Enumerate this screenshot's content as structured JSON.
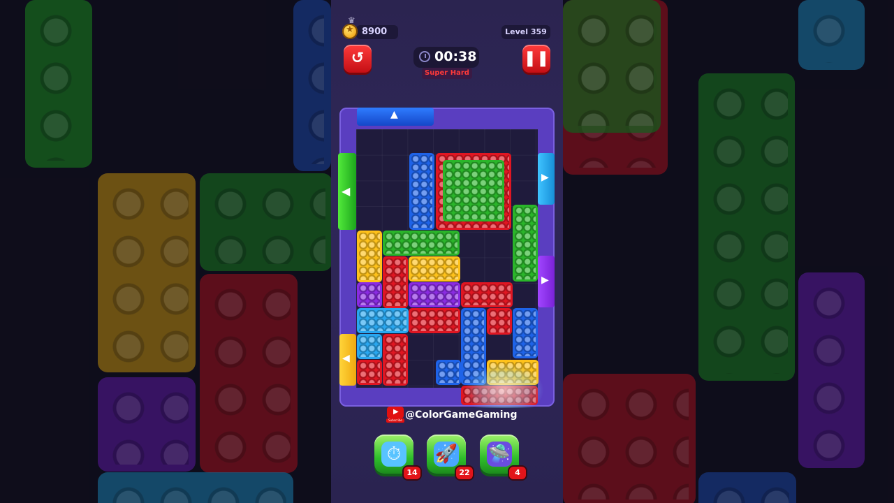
{
  "header": {
    "coins": "8900",
    "level": "Level 359",
    "timer": "00:38",
    "difficulty": "Super Hard"
  },
  "controls": {
    "restart_icon": "restart-icon",
    "pause_icon": "pause-icon"
  },
  "board": {
    "block_colors": {
      "red": "#e01622",
      "green": "#2ab52a",
      "blue": "#1e63e8",
      "yellow": "#ffc21a",
      "purple": "#8a2be2",
      "cyan": "#29a7f0"
    }
  },
  "watermark": {
    "handle": "@ColorGameGaming",
    "subscribe": "Subscribe"
  },
  "boosters": [
    {
      "name": "freeze-clock",
      "icon": "clock-freeze-icon",
      "count": "14"
    },
    {
      "name": "rocket",
      "icon": "rocket-icon",
      "count": "22"
    },
    {
      "name": "ufo",
      "icon": "ufo-icon",
      "count": "4"
    }
  ]
}
